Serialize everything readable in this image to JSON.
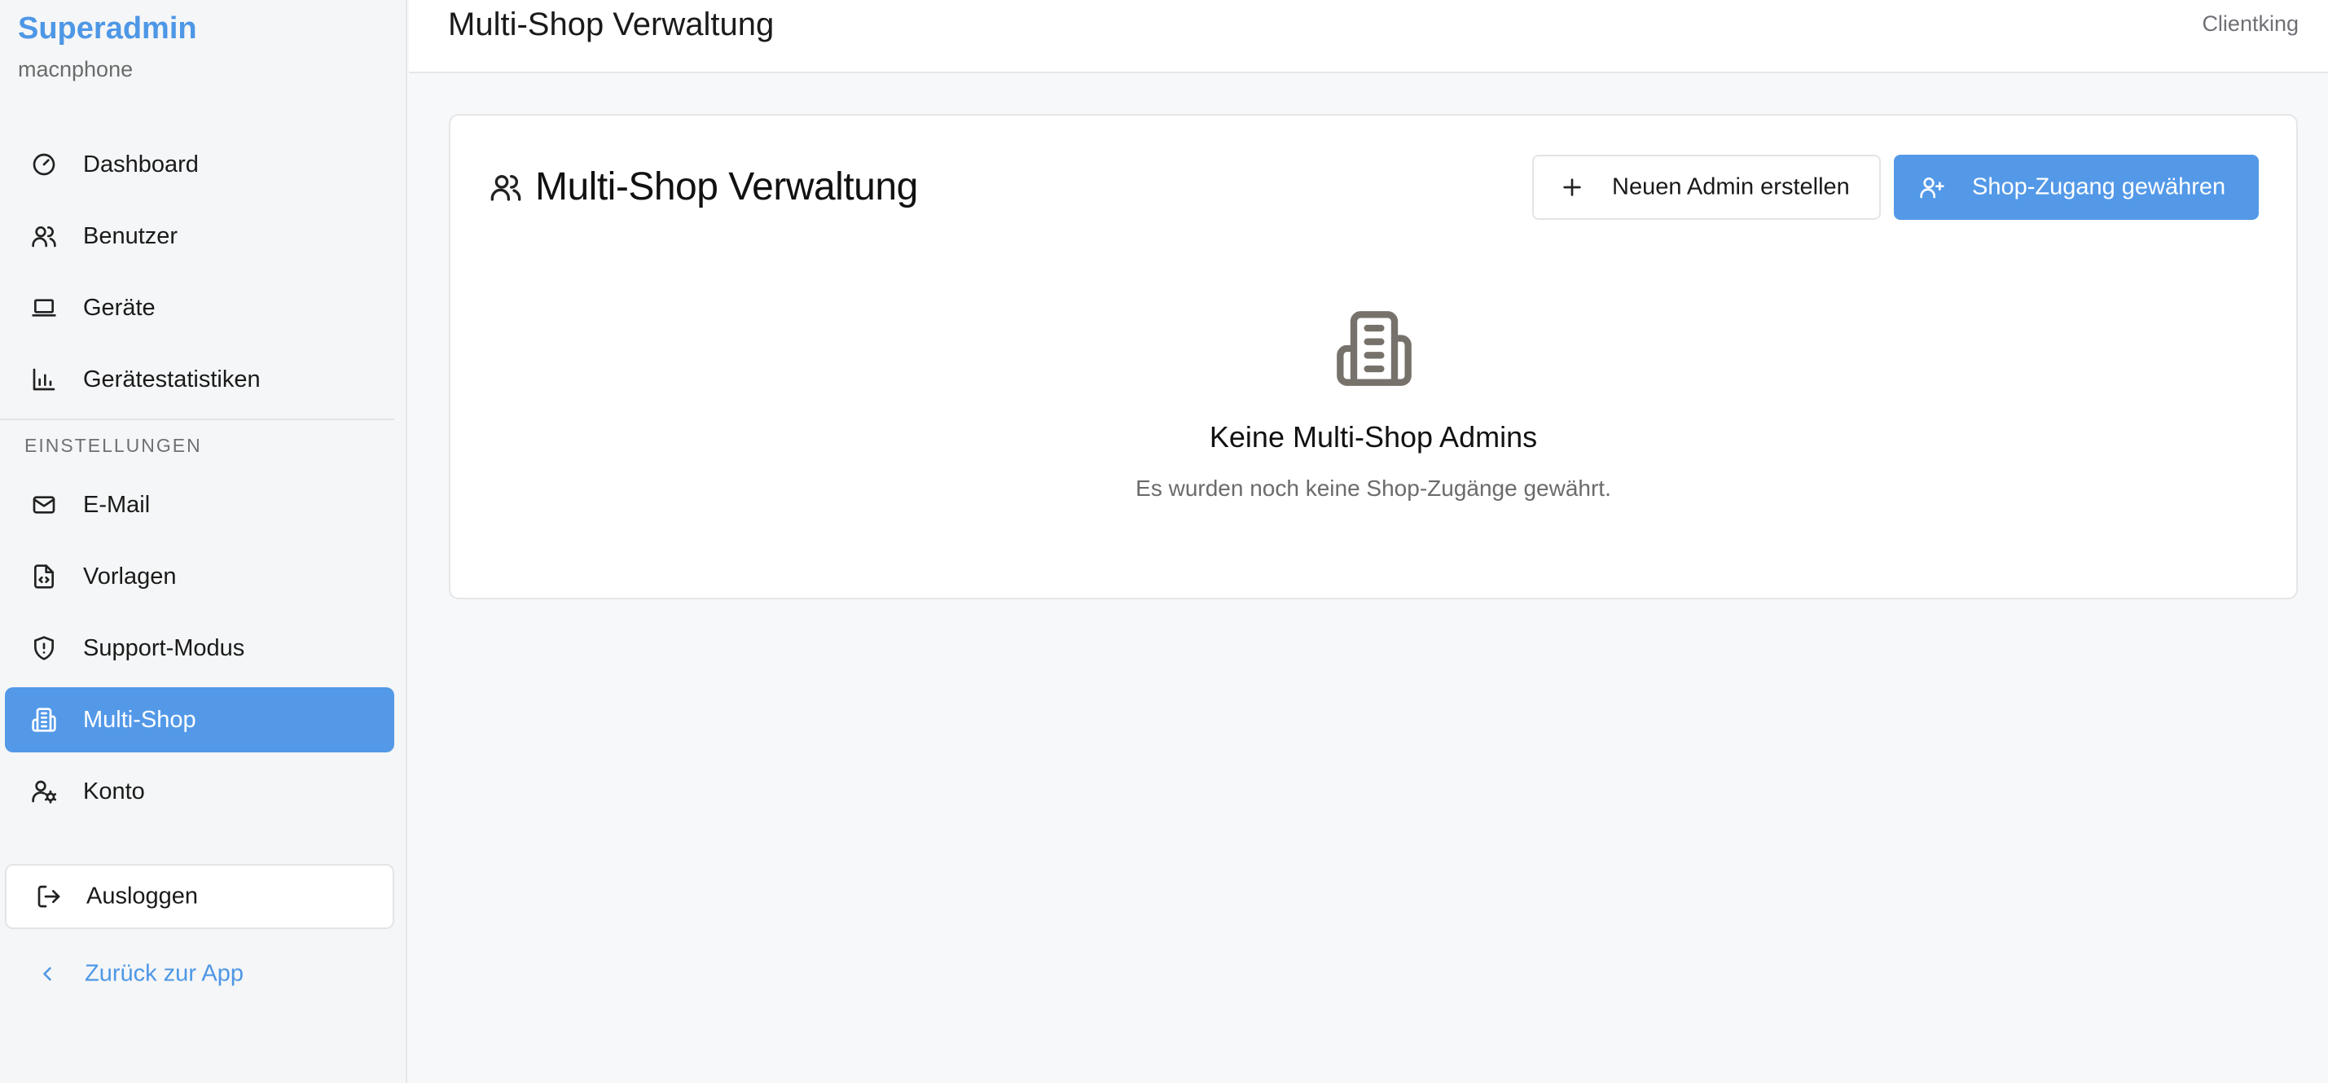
{
  "sidebar": {
    "brand_title": "Superadmin",
    "brand_subtitle": "macnphone",
    "items": [
      {
        "label": "Dashboard",
        "icon": "gauge-icon"
      },
      {
        "label": "Benutzer",
        "icon": "users-icon"
      },
      {
        "label": "Geräte",
        "icon": "laptop-icon"
      },
      {
        "label": "Gerätestatistiken",
        "icon": "bar-chart-icon"
      }
    ],
    "section_label": "EINSTELLUNGEN",
    "settings_items": [
      {
        "label": "E-Mail",
        "icon": "mail-icon"
      },
      {
        "label": "Vorlagen",
        "icon": "file-code-icon"
      },
      {
        "label": "Support-Modus",
        "icon": "shield-icon"
      },
      {
        "label": "Multi-Shop",
        "icon": "building-icon",
        "active": true
      },
      {
        "label": "Konto",
        "icon": "user-cog-icon"
      }
    ],
    "logout_label": "Ausloggen",
    "back_label": "Zurück zur App"
  },
  "header": {
    "title": "Multi-Shop Verwaltung",
    "user": "Clientking"
  },
  "main": {
    "card_title": "Multi-Shop Verwaltung",
    "new_admin_label": "Neuen Admin erstellen",
    "grant_access_label": "Shop-Zugang gewähren",
    "empty_title": "Keine Multi-Shop Admins",
    "empty_subtitle": "Es wurden noch keine Shop-Zugänge gewährt."
  },
  "colors": {
    "accent": "#5399e8",
    "brand": "#4e97e6"
  }
}
